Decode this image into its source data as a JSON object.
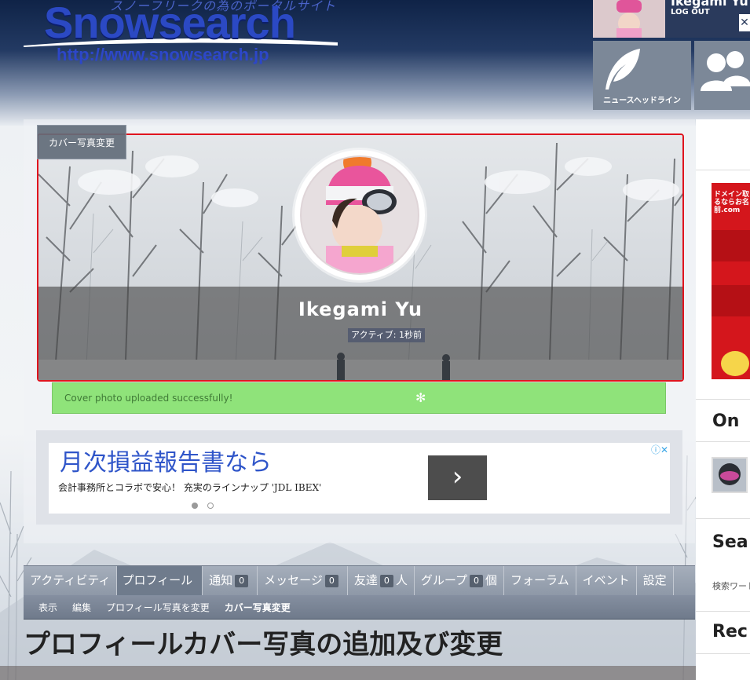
{
  "site": {
    "logo_subtitle": "スノーフリークの為のポータルサイト",
    "logo_name": "Snowsearch",
    "logo_url": "http://www.snowsearch.jp"
  },
  "header": {
    "user_name": "Ikegami Yu",
    "logout_label": "LOG OUT",
    "tiles": [
      {
        "label": "ニュースヘッドライン",
        "icon": "feather-icon"
      },
      {
        "label": "",
        "icon": "people-icon"
      }
    ]
  },
  "profile": {
    "change_cover_label": "カバー写真変更",
    "name": "Ikegami Yu",
    "active_status": "アクティブ: 1秒前",
    "notice": "Cover photo uploaded successfully!"
  },
  "ad": {
    "title": "月次損益報告書なら",
    "body": "会計事務所とコラボで安心！ 充実のラインナップ 'JDL IBEX'",
    "arrow": "›",
    "info": "ⓘ✕"
  },
  "nav": {
    "items": [
      {
        "label": "アクティビティ",
        "count": "",
        "suffix": ""
      },
      {
        "label": "プロフィール",
        "count": "",
        "suffix": "",
        "active": true
      },
      {
        "label": "通知",
        "count": "0",
        "suffix": ""
      },
      {
        "label": "メッセージ",
        "count": "0",
        "suffix": ""
      },
      {
        "label": "友達",
        "count": "0",
        "suffix": "人"
      },
      {
        "label": "グループ",
        "count": "0",
        "suffix": "個"
      },
      {
        "label": "フォーラム",
        "count": "",
        "suffix": ""
      },
      {
        "label": "イベント",
        "count": "",
        "suffix": ""
      },
      {
        "label": "設定",
        "count": "",
        "suffix": ""
      }
    ],
    "sub_items": [
      "表示",
      "編集",
      "プロフィール写真を変更",
      "カバー写真変更"
    ]
  },
  "page": {
    "title": "プロフィールカバー写真の追加及び変更"
  },
  "sidebar": {
    "ad_text": "ドメイン取るならお名前.com",
    "heading_on": "On",
    "heading_search": "Sea",
    "search_label": "検索ワード",
    "heading_recent": "Rec"
  },
  "colors": {
    "accent": "#2b49c4",
    "nav": "#8e98a7",
    "notice_bg": "#8fe37a",
    "cover_border": "#e0141e"
  }
}
